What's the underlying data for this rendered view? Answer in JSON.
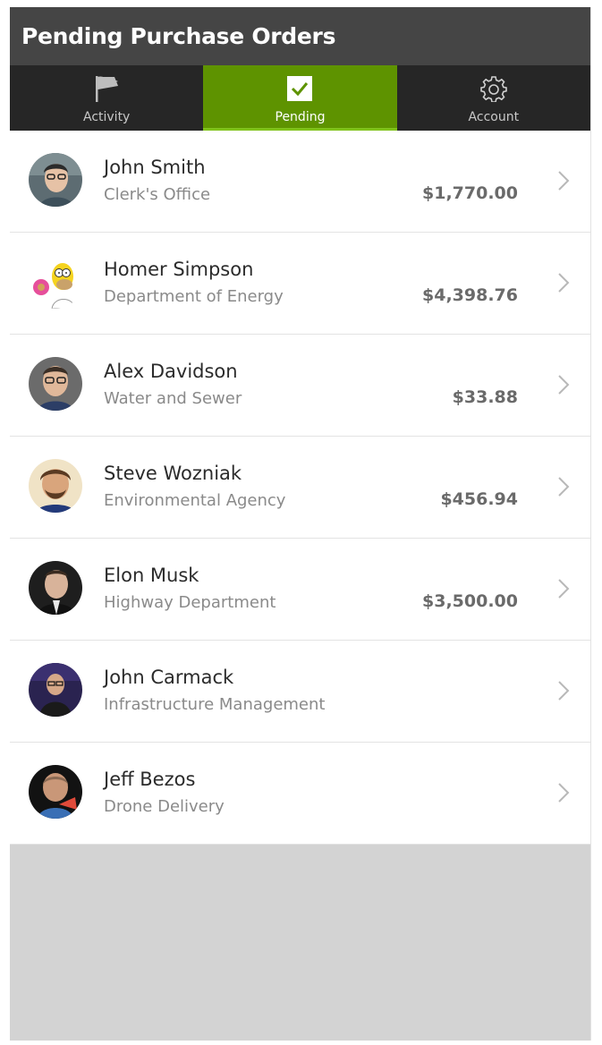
{
  "header": {
    "title": "Pending Purchase Orders"
  },
  "tabs": [
    {
      "label": "Activity",
      "icon": "flag-icon",
      "active": false
    },
    {
      "label": "Pending",
      "icon": "checkbox-icon",
      "active": true
    },
    {
      "label": "Account",
      "icon": "gear-icon",
      "active": false
    }
  ],
  "orders": [
    {
      "name": "John Smith",
      "dept": "Clerk's Office",
      "amount": "$1,770.00"
    },
    {
      "name": "Homer Simpson",
      "dept": "Department of Energy",
      "amount": "$4,398.76"
    },
    {
      "name": "Alex Davidson",
      "dept": "Water and Sewer",
      "amount": "$33.88"
    },
    {
      "name": "Steve Wozniak",
      "dept": "Environmental Agency",
      "amount": "$456.94"
    },
    {
      "name": "Elon Musk",
      "dept": "Highway Department",
      "amount": "$3,500.00"
    },
    {
      "name": "John Carmack",
      "dept": "Infrastructure Management",
      "amount": ""
    },
    {
      "name": "Jeff Bezos",
      "dept": "Drone Delivery",
      "amount": ""
    }
  ],
  "colors": {
    "accent": "#5e9300",
    "titlebar": "#454545",
    "tabbar": "#262626"
  }
}
